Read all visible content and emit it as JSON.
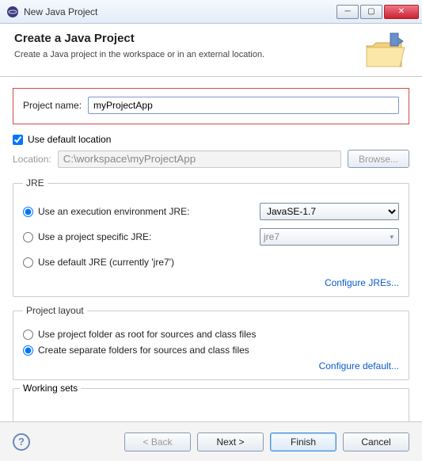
{
  "window": {
    "title": "New Java Project"
  },
  "header": {
    "title": "Create a Java Project",
    "subtitle": "Create a Java project in the workspace or in an external location."
  },
  "projectName": {
    "label": "Project name:",
    "value": "myProjectApp"
  },
  "location": {
    "useDefault": "Use default location",
    "label": "Location:",
    "path": "C:\\workspace\\myProjectApp",
    "browse": "Browse..."
  },
  "jre": {
    "legend": "JRE",
    "execEnv": "Use an execution environment JRE:",
    "execEnvValue": "JavaSE-1.7",
    "projectJre": "Use a project specific JRE:",
    "projectJreValue": "jre7",
    "defaultJre": "Use default JRE (currently 'jre7')",
    "configure": "Configure JREs..."
  },
  "layout": {
    "legend": "Project layout",
    "root": "Use project folder as root for sources and class files",
    "separate": "Create separate folders for sources and class files",
    "configure": "Configure default..."
  },
  "workingSets": {
    "legend": "Working sets"
  },
  "buttons": {
    "back": "< Back",
    "next": "Next >",
    "finish": "Finish",
    "cancel": "Cancel"
  }
}
